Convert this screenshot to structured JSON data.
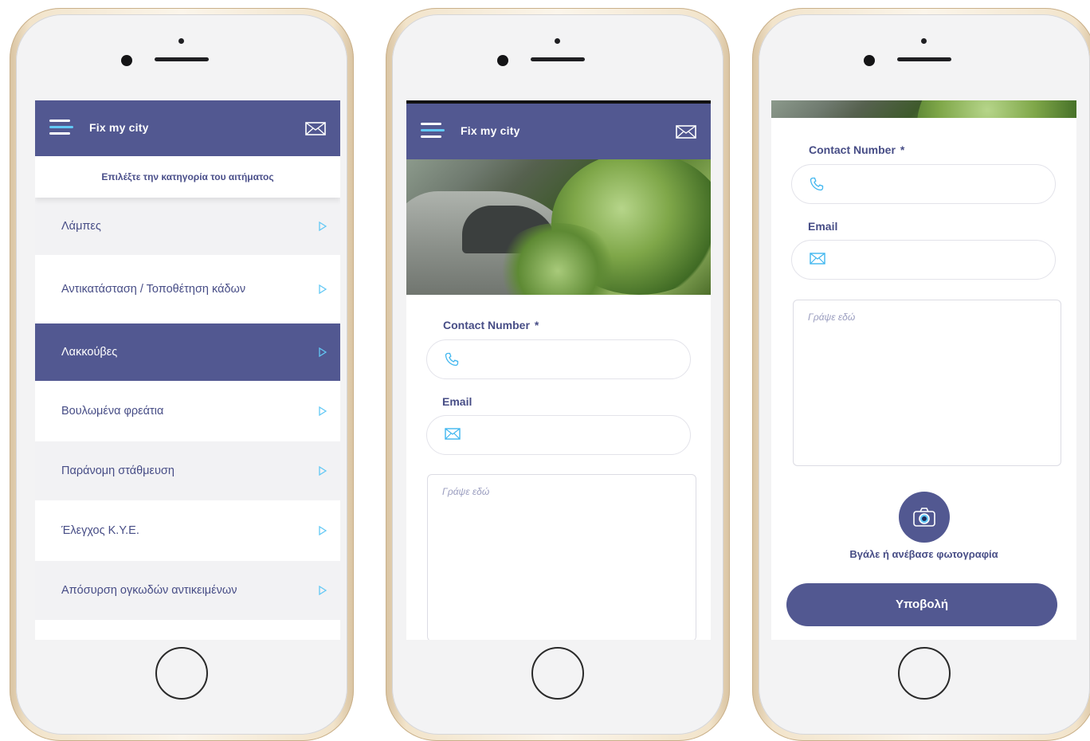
{
  "app": {
    "title": "Fix my city"
  },
  "screen1": {
    "subtitle": "Επιλέξτε την κατηγορία του αιτήματος",
    "categories": [
      {
        "label": "Λάμπες"
      },
      {
        "label": "Αντικατάσταση / Τοποθέτηση κάδων"
      },
      {
        "label": "Λακκούβες",
        "selected": true
      },
      {
        "label": "Βουλωμένα φρεάτια"
      },
      {
        "label": "Παράνομη στάθμευση"
      },
      {
        "label": "Έλεγχος Κ.Υ.Ε."
      },
      {
        "label": "Απόσυρση ογκωδών αντικειμένων"
      }
    ]
  },
  "form": {
    "contact_label": "Contact Number",
    "required_mark": "*",
    "contact_value": "",
    "email_label": "Email",
    "email_value": "",
    "message_placeholder": "Γράψε εδώ",
    "photo_label": "Βγάλε ή ανέβασε φωτογραφία",
    "submit_label": "Υποβολή"
  },
  "colors": {
    "brand": "#525891",
    "accent": "#62c8f5",
    "text": "#474d86",
    "alt_row": "#f2f2f4"
  },
  "icons": [
    "menu-icon",
    "mail-icon",
    "chevron-right-icon",
    "phone-icon",
    "envelope-icon",
    "camera-icon"
  ]
}
